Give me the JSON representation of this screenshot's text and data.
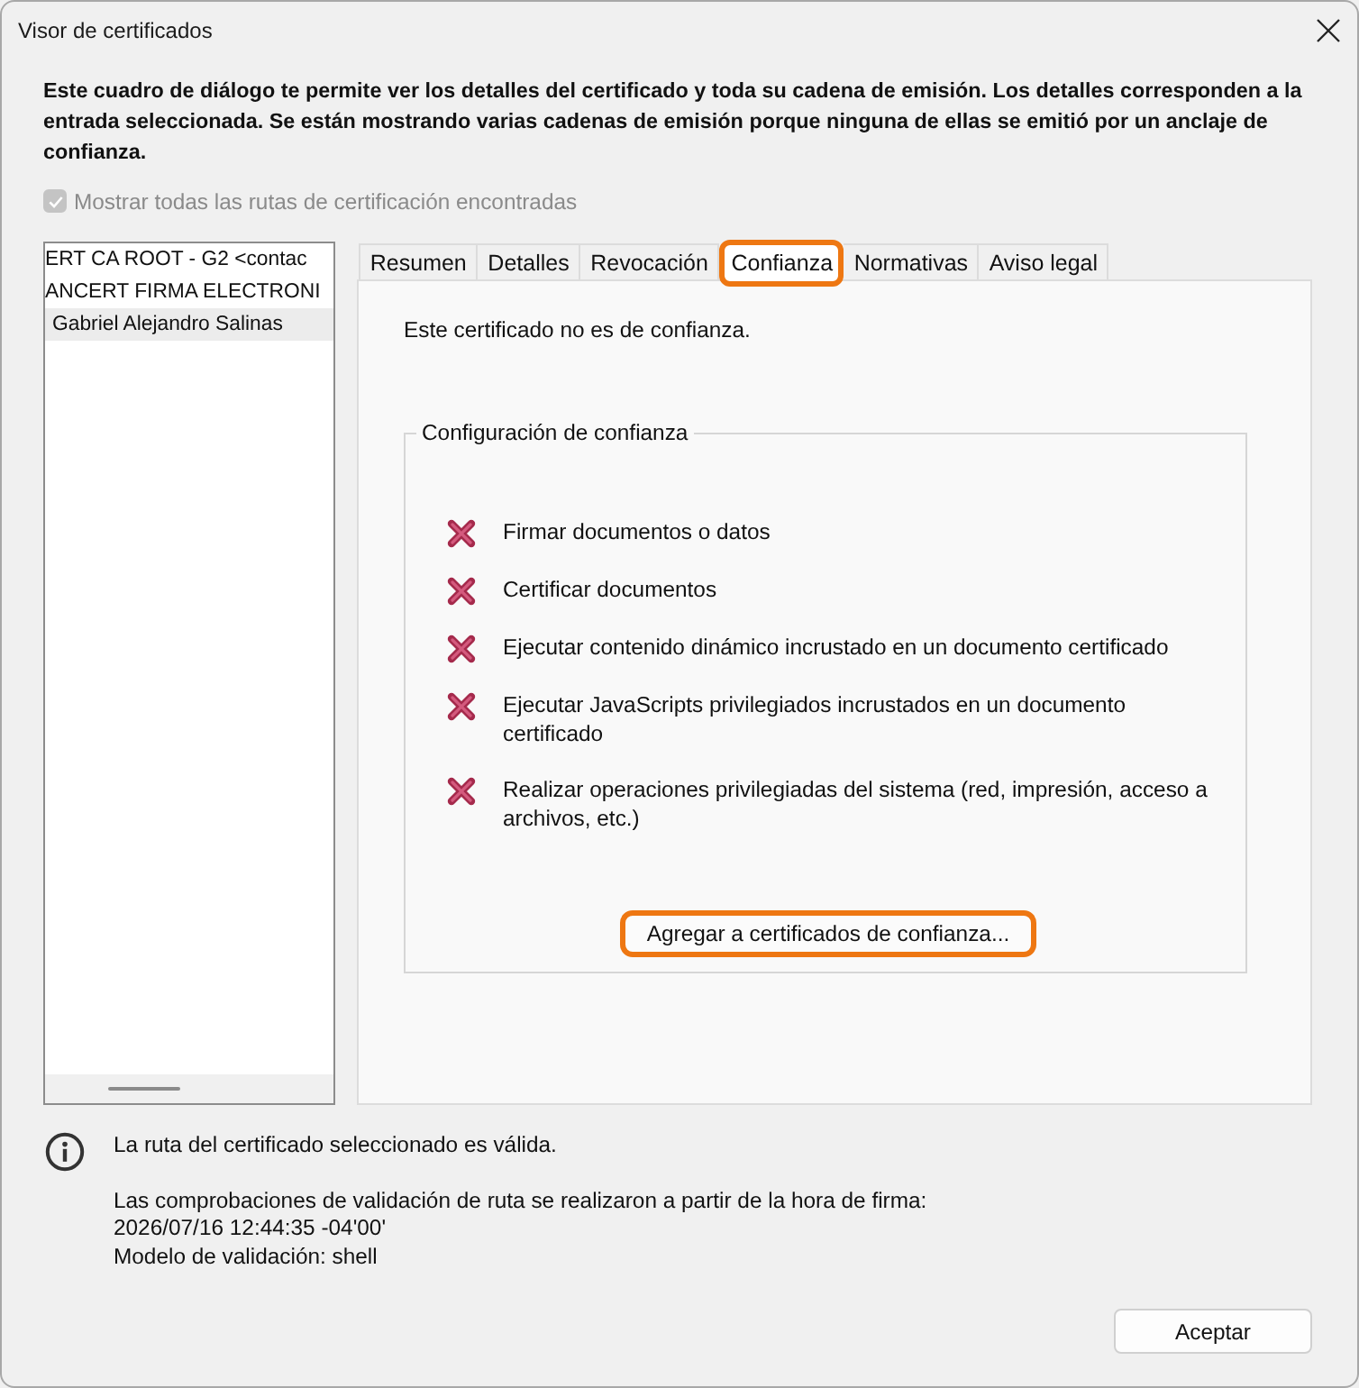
{
  "window": {
    "title": "Visor de certificados"
  },
  "description": "Este cuadro de diálogo te permite ver los detalles del certificado y toda su cadena de emisión. Los detalles corresponden a la entrada seleccionada. Se están mostrando varias cadenas de emisión porque ninguna de ellas se emitió por un anclaje de confianza.",
  "show_all_paths": {
    "label": "Mostrar todas las rutas de certificación encontradas",
    "checked": true,
    "disabled": true
  },
  "certificate_tree": {
    "items": [
      {
        "label": "ERT CA ROOT - G2 <contac",
        "selected": false
      },
      {
        "label": "ANCERT FIRMA ELECTRONI",
        "selected": false
      },
      {
        "label": "Gabriel Alejandro Salinas",
        "selected": true
      }
    ]
  },
  "tabs": [
    {
      "label": "Resumen",
      "selected": false,
      "highlighted": false
    },
    {
      "label": "Detalles",
      "selected": false,
      "highlighted": false
    },
    {
      "label": "Revocación",
      "selected": false,
      "highlighted": false
    },
    {
      "label": "Confianza",
      "selected": true,
      "highlighted": true
    },
    {
      "label": "Normativas",
      "selected": false,
      "highlighted": false
    },
    {
      "label": "Aviso legal",
      "selected": false,
      "highlighted": false
    }
  ],
  "trust_panel": {
    "status": "Este certificado no es de confianza.",
    "group_title": "Configuración de confianza",
    "permissions": [
      {
        "label": "Firmar documentos o datos",
        "allowed": false
      },
      {
        "label": "Certificar documentos",
        "allowed": false
      },
      {
        "label": "Ejecutar contenido dinámico incrustado en un documento certificado",
        "allowed": false
      },
      {
        "label": "Ejecutar JavaScripts privilegiados incrustados en un documento certificado",
        "allowed": false
      },
      {
        "label": "Realizar operaciones privilegiadas del sistema (red, impresión, acceso a archivos, etc.)",
        "allowed": false
      }
    ],
    "add_button": {
      "label": "Agregar a certificados de confianza...",
      "highlighted": true
    }
  },
  "validation": {
    "status": "La ruta del certificado seleccionado es válida.",
    "details": [
      "Las comprobaciones de validación de ruta se realizaron a partir de la hora de firma:",
      "2026/07/16 12:44:35 -04'00'",
      "Modelo de validación: shell"
    ]
  },
  "buttons": [
    {
      "label": "Aceptar"
    }
  ]
}
